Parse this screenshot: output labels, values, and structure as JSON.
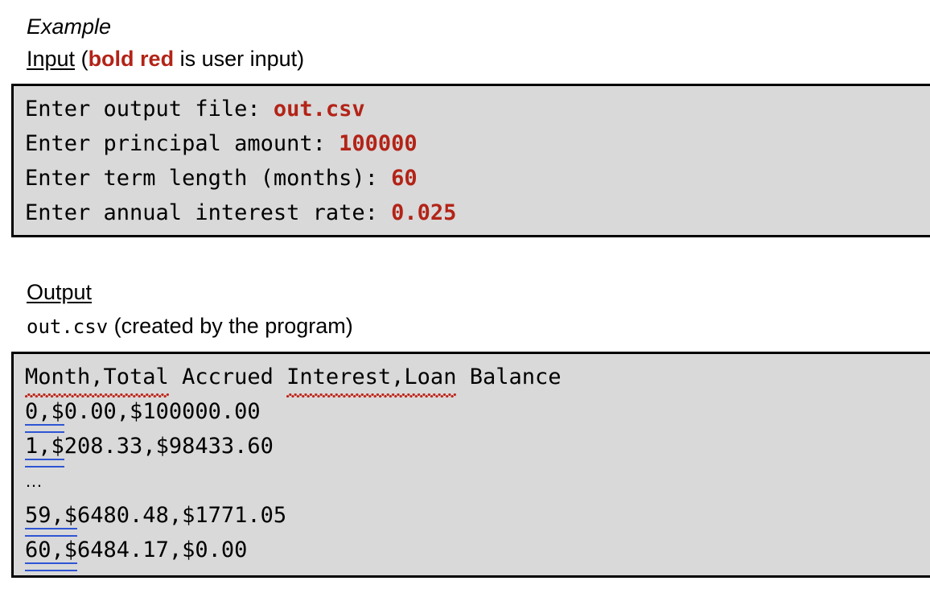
{
  "headings": {
    "example": "Example",
    "input_label": "Input",
    "input_note_open": " (",
    "input_note_bold": "bold red",
    "input_note_rest": " is user input)",
    "output_label": "Output",
    "output_file": "out.csv",
    "output_file_note": "  (created by the program)"
  },
  "colors": {
    "user_input_red": "#B32317",
    "box_fill": "#D9D9D9",
    "box_border": "#000000",
    "spellcheck_red": "#C0271B",
    "grammar_blue": "#2F55D4"
  },
  "input_console": {
    "lines": [
      {
        "prompt": "Enter output file: ",
        "value": "out.csv"
      },
      {
        "prompt": "Enter principal amount: ",
        "value": "100000"
      },
      {
        "prompt": "Enter term length (months): ",
        "value": "60"
      },
      {
        "prompt": "Enter annual interest rate: ",
        "value": "0.025"
      }
    ]
  },
  "output_csv": {
    "header": {
      "seg1": "Month,Total",
      "seg2": " Accrued ",
      "seg3": "Interest,Loan",
      "seg4": " Balance"
    },
    "rows": [
      {
        "mark": "0,$",
        "rest": "0.00,$100000.00"
      },
      {
        "mark": "1,$",
        "rest": "208.33,$98433.60"
      }
    ],
    "ellipsis": "…",
    "rows_tail": [
      {
        "mark": "59,$",
        "rest": "6480.48,$1771.05"
      },
      {
        "mark": "60,$",
        "rest": "6484.17,$0.00"
      }
    ]
  }
}
